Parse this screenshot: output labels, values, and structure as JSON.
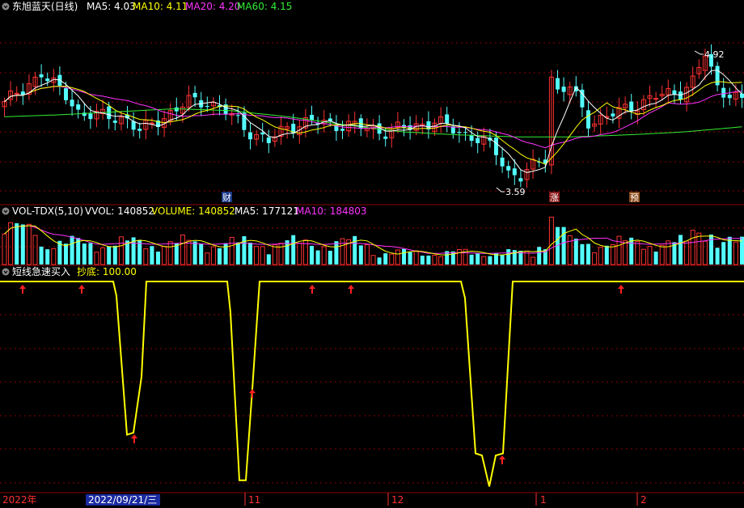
{
  "price_panel": {
    "title": "东旭蓝天(日线)",
    "indicators": [
      {
        "label": "MA5: 4.03",
        "color": "#ffffff"
      },
      {
        "label": "MA10: 4.11",
        "color": "#ffff00"
      },
      {
        "label": "MA20: 4.20",
        "color": "#ff33ff"
      },
      {
        "label": "MA60: 4.15",
        "color": "#33ee33"
      }
    ],
    "high_label": "4.92",
    "low_label": "3.59",
    "event_markers": [
      "财",
      "涨",
      "预"
    ]
  },
  "volume_panel": {
    "title": "VOL-TDX(5,10)",
    "indicators": [
      {
        "label": "VVOL: 140852",
        "color": "#ffffff"
      },
      {
        "label": "VOLUME: 140852",
        "color": "#ffff00"
      },
      {
        "label": "MA5: 177121",
        "color": "#ffffff"
      },
      {
        "label": "MA10: 184803",
        "color": "#ff33ff"
      }
    ]
  },
  "signal_panel": {
    "title": "短线急速买入",
    "indicators": [
      {
        "label": "抄底: 100.00",
        "color": "#ffff00"
      }
    ]
  },
  "time_axis": {
    "labels": [
      "2022年",
      "2022/09/21/三",
      "11",
      "12",
      "1",
      "2"
    ]
  },
  "colors": {
    "up": "#ff3232",
    "down": "#54ffff",
    "ma5": "#ffffff",
    "ma10": "#ffff00",
    "ma20": "#ff33ff",
    "ma60": "#33ee33",
    "signal": "#ffff00",
    "arrow": "#ff2020",
    "grid": "#8b0000",
    "axis_text": "#ff3232"
  }
}
